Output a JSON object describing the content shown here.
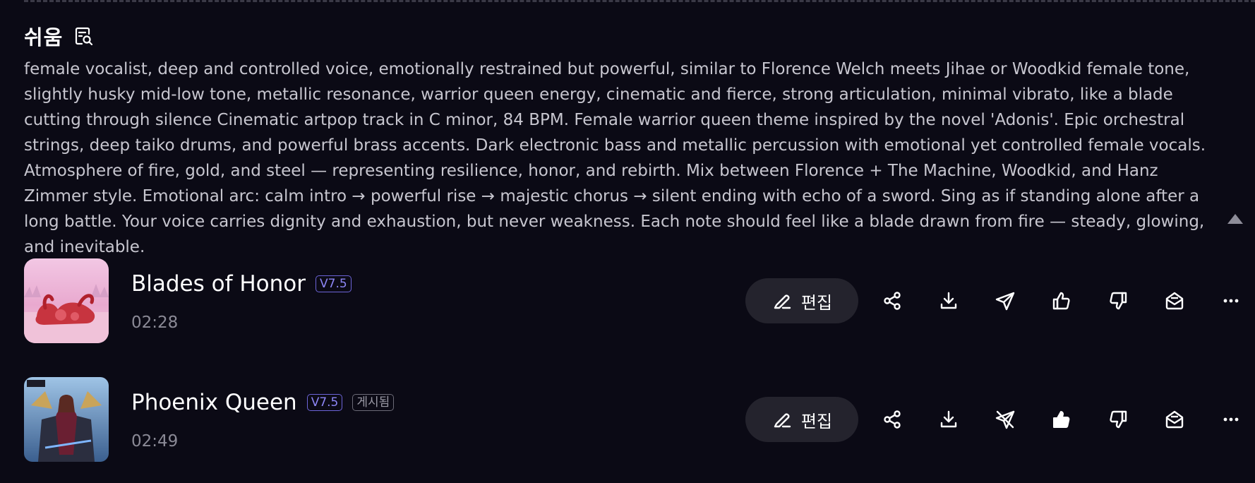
{
  "header": {
    "title": "쉬움"
  },
  "description": "female vocalist, deep and controlled voice, emotionally restrained but powerful, similar to Florence Welch meets Jihae or Woodkid female tone, slightly husky mid-low tone, metallic resonance, warrior queen energy, cinematic and fierce, strong articulation, minimal vibrato, like a blade cutting through silence Cinematic artpop track in C minor, 84 BPM. Female warrior queen theme inspired by the novel 'Adonis'. Epic orchestral strings, deep taiko drums, and powerful brass accents. Dark electronic bass and metallic percussion with emotional yet controlled female vocals. Atmosphere of fire, gold, and steel — representing resilience, honor, and rebirth. Mix between Florence + The Machine, Woodkid, and Hanz Zimmer style. Emotional arc: calm intro → powerful rise → majestic chorus → silent ending with echo of a sword. Sing as if standing alone after a long battle. Your voice carries dignity and exhaustion, but never weakness. Each note should feel like a blade drawn from fire — steady, glowing, and inevitable.",
  "icons": {
    "header": "search-document-icon",
    "collapse": "caret-up-icon",
    "edit": "pencil-icon",
    "share": "share-icon",
    "download": "download-icon",
    "send": "send-icon",
    "send_disabled": "send-off-icon",
    "like": "thumbs-up-icon",
    "dislike": "thumbs-down-icon",
    "inbox": "mail-icon",
    "more": "more-horizontal-icon"
  },
  "songs": [
    {
      "title": "Blades of Honor",
      "version": "V7.5",
      "published_label": "",
      "duration": "02:28",
      "edit_label": "편집",
      "liked": false,
      "send_disabled": false
    },
    {
      "title": "Phoenix Queen",
      "version": "V7.5",
      "published_label": "게시됨",
      "duration": "02:49",
      "edit_label": "편집",
      "liked": true,
      "send_disabled": true
    }
  ],
  "colors": {
    "background": "#0b0a15",
    "version_badge": "#8d86f5",
    "edit_button_bg": "#24232d"
  }
}
